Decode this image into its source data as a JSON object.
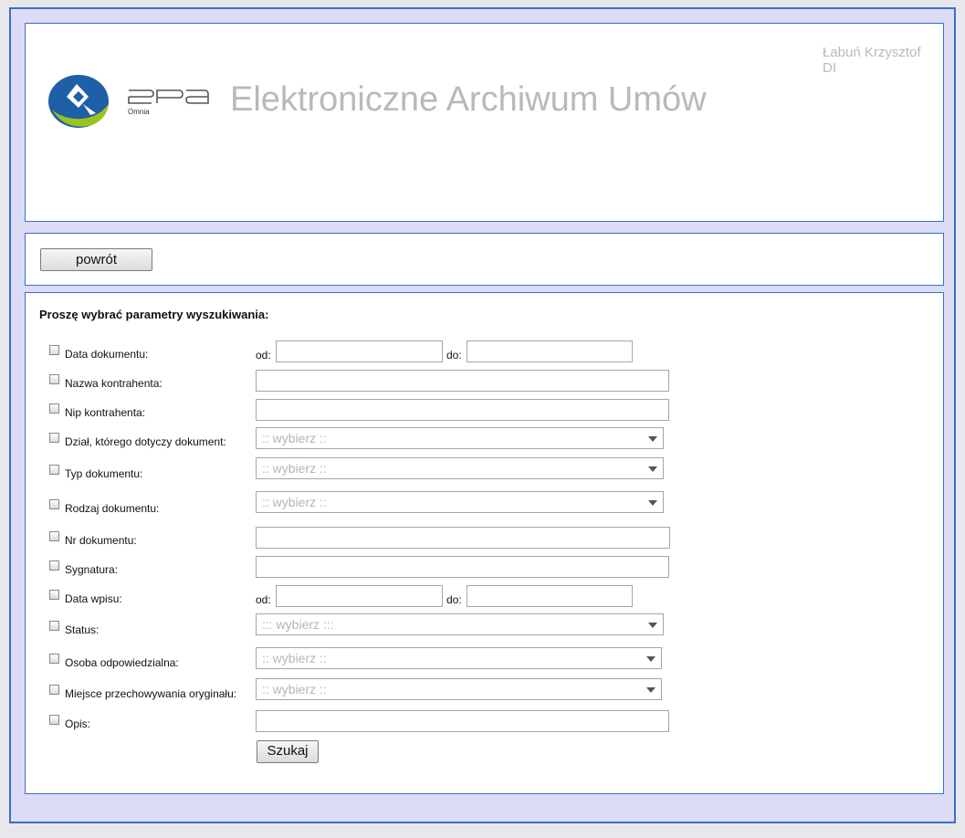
{
  "header": {
    "logo_text": "epa",
    "logo_subtext": "Omnia",
    "app_title": "Elektroniczne Archiwum Umów",
    "user_name": "Łabuń Krzysztof",
    "user_dept": "DI"
  },
  "nav": {
    "back_label": "powrót"
  },
  "form": {
    "title": "Proszę wybrać parametry wyszukiwania:",
    "from_label": "od:",
    "to_label": "do:",
    "fields": {
      "data_dokumentu": "Data dokumentu:",
      "nazwa_kontrahenta": "Nazwa kontrahenta:",
      "nip_kontrahenta": "Nip kontrahenta:",
      "dzial": "Dział, którego dotyczy dokument:",
      "typ_dokumentu": "Typ dokumentu:",
      "rodzaj_dokumentu": "Rodzaj dokumentu:",
      "nr_dokumentu": "Nr dokumentu:",
      "sygnatura": "Sygnatura:",
      "data_wpisu": "Data wpisu:",
      "status": "Status:",
      "osoba": "Osoba odpowiedzialna:",
      "miejsce": "Miejsce przechowywania oryginału:",
      "opis": "Opis:"
    },
    "select_placeholder": ":: wybierz ::",
    "status_placeholder": "::: wybierz :::",
    "search_label": "Szukaj"
  },
  "colors": {
    "border": "#3a6fc8",
    "background": "#dcdcf7",
    "title_gray": "#b9b9b9"
  }
}
